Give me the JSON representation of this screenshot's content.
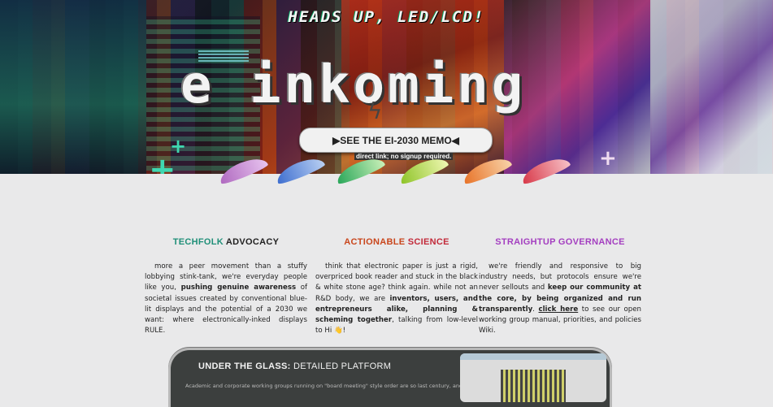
{
  "hero": {
    "subtitle": "HEADS UP, LED/LCD!",
    "title": "e inkoming",
    "cta_label": "▶SEE THE EI-2030 MEMO◀",
    "cta_note": "direct link; no signup required."
  },
  "columns": [
    {
      "title_a": "TECHFOLK",
      "title_b": " ADVOCACY",
      "color_a": "#1f8f78",
      "text_1": "more a peer movement than a stuffy lobbying stink-tank, we're everyday people like you, ",
      "bold_1": "pushing genuine awareness",
      "text_2": " of societal issues created by conventional blue-lit displays and the potential of a 2030 we want: where electronically-inked displays RULE."
    },
    {
      "title_a": "ACTIONABLE",
      "title_b": " SCIENCE",
      "color_a": "#c9461c",
      "text_1": "think that electronic paper is just a rigid, overpriced book reader and stuck in the black & white stone age? think again. while not an R&D body, we are ",
      "bold_1": "inventors, users, and entrepreneurs alike, planning & scheming together",
      "text_2": ", talking from low-level to Hi 👋!"
    },
    {
      "title_a": "STRAIGHTUP",
      "title_b": " GOVERNANCE",
      "color_a": "#a43fc0",
      "text_1": "we're friendly and responsive to big industry needs, but protocols ensure we're never sellouts and ",
      "bold_1": "keep our community at the core, by being organized and run transparently",
      "text_2": ". ",
      "link": "click here",
      "text_3": " to see our open working group manual, priorities, and policies Wiki."
    }
  ],
  "panel": {
    "title_a": "UNDER THE GLASS:",
    "title_b": " DETAILED PLATFORM",
    "text": "Academic and corporate working groups running on \"board meeting\" style order are so last century, and don't have"
  },
  "colors": {
    "title_b": "#c22a3a",
    "background": "#e9e9ea",
    "panel": "#3c3f3e"
  }
}
